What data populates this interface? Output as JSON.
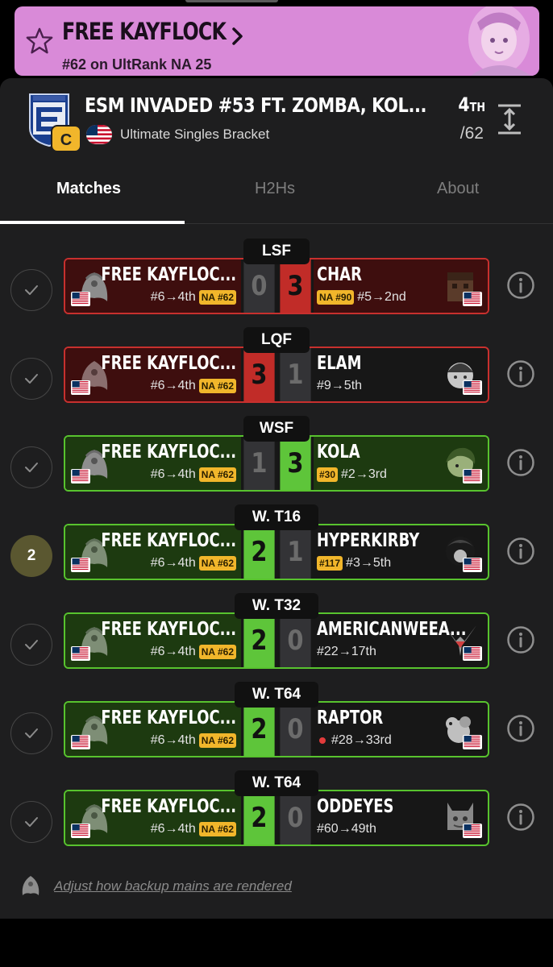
{
  "banner": {
    "player_name": "FREE KAYFLOCK",
    "rank_text": "#62 on UltRank NA 25",
    "icons": [
      "star-icon",
      "chevron-right-icon"
    ]
  },
  "event": {
    "title": "ESM INVADED #53 FT. ZOMBA, KOL...",
    "tier": "C",
    "subtitle": "Ultimate Singles Bracket",
    "placement": "4",
    "placement_suffix": "TH",
    "entrants": "/62"
  },
  "tabs": [
    {
      "label": "Matches",
      "active": true
    },
    {
      "label": "H2Hs",
      "active": false
    },
    {
      "label": "About",
      "active": false
    }
  ],
  "colors": {
    "win": "#5ec53a",
    "loss": "#c12c28",
    "badge": "#f1b62b",
    "banner": "#d98ad8"
  },
  "matches": [
    {
      "round": "LSF",
      "status": "check",
      "p1": {
        "name": "FREE KAYFLOC...",
        "seed": "#6→4th",
        "badge": "NA #62"
      },
      "p1_score": "0",
      "p2_score": "3",
      "p2": {
        "name": "CHAR",
        "badge": "NA #90",
        "seed": "#5→2nd"
      }
    },
    {
      "round": "LQF",
      "status": "check",
      "p1": {
        "name": "FREE KAYFLOC...",
        "seed": "#6→4th",
        "badge": "NA #62"
      },
      "p1_score": "3",
      "p2_score": "1",
      "p2": {
        "name": "ELAM",
        "badge": "",
        "seed": "#9→5th"
      }
    },
    {
      "round": "WSF",
      "status": "check",
      "p1": {
        "name": "FREE KAYFLOC...",
        "seed": "#6→4th",
        "badge": "NA #62"
      },
      "p1_score": "1",
      "p2_score": "3",
      "p2": {
        "name": "KOLA",
        "badge": "#30",
        "seed": "#2→3rd"
      }
    },
    {
      "round": "W. T16",
      "status": "2",
      "p1": {
        "name": "FREE KAYFLOC...",
        "seed": "#6→4th",
        "badge": "NA #62"
      },
      "p1_score": "2",
      "p2_score": "1",
      "p2": {
        "name": "HYPERKIRBY",
        "badge": "#117",
        "seed": "#3→5th"
      }
    },
    {
      "round": "W. T32",
      "status": "check",
      "p1": {
        "name": "FREE KAYFLOC...",
        "seed": "#6→4th",
        "badge": "NA #62"
      },
      "p1_score": "2",
      "p2_score": "0",
      "p2": {
        "name": "AMERICANWEEA...",
        "badge": "",
        "seed": "#22→17th"
      }
    },
    {
      "round": "W. T64",
      "status": "check",
      "p1": {
        "name": "FREE KAYFLOC...",
        "seed": "#6→4th",
        "badge": "NA #62"
      },
      "p1_score": "2",
      "p2_score": "0",
      "p2": {
        "name": "RAPTOR",
        "badge": "",
        "seed": "#28→33rd"
      }
    },
    {
      "round": "W. T64",
      "status": "check",
      "p1": {
        "name": "FREE KAYFLOC...",
        "seed": "#6→4th",
        "badge": "NA #62"
      },
      "p1_score": "2",
      "p2_score": "0",
      "p2": {
        "name": "ODDEYES",
        "badge": "",
        "seed": "#60→49th"
      }
    }
  ],
  "footer": {
    "link_text": "Adjust how backup mains are rendered"
  }
}
